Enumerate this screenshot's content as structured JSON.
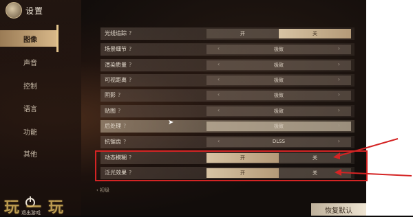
{
  "header": {
    "title": "设置"
  },
  "sidebar": {
    "items": [
      {
        "label": "图像",
        "active": true
      },
      {
        "label": "声音"
      },
      {
        "label": "控制"
      },
      {
        "label": "语言"
      },
      {
        "label": "功能"
      },
      {
        "label": "其他"
      }
    ],
    "exit_label": "退出游戏"
  },
  "settings": [
    {
      "label": "光线追踪",
      "type": "toggle",
      "on": "开",
      "off": "关",
      "selected": "关"
    },
    {
      "label": "场景细节",
      "type": "select",
      "value": "极致"
    },
    {
      "label": "渲染质量",
      "type": "select",
      "value": "极致"
    },
    {
      "label": "可视距离",
      "type": "select",
      "value": "极致"
    },
    {
      "label": "阴影",
      "type": "select",
      "value": "极致"
    },
    {
      "label": "贴图",
      "type": "select",
      "value": "极致"
    },
    {
      "label": "后处理",
      "type": "select",
      "value": "极致"
    },
    {
      "label": "抗锯齿",
      "type": "select",
      "value": "DLSS"
    },
    {
      "label": "动态模糊",
      "type": "toggle",
      "on": "开",
      "off": "关",
      "selected": "开"
    },
    {
      "label": "泛光效果",
      "type": "toggle",
      "on": "开",
      "off": "关",
      "selected": "开"
    }
  ],
  "more_label": "初级",
  "reset_button": "恢复默认",
  "watermark": "玩一玩",
  "colors": {
    "annotation": "#d42424",
    "accent": "#d9b98a"
  }
}
